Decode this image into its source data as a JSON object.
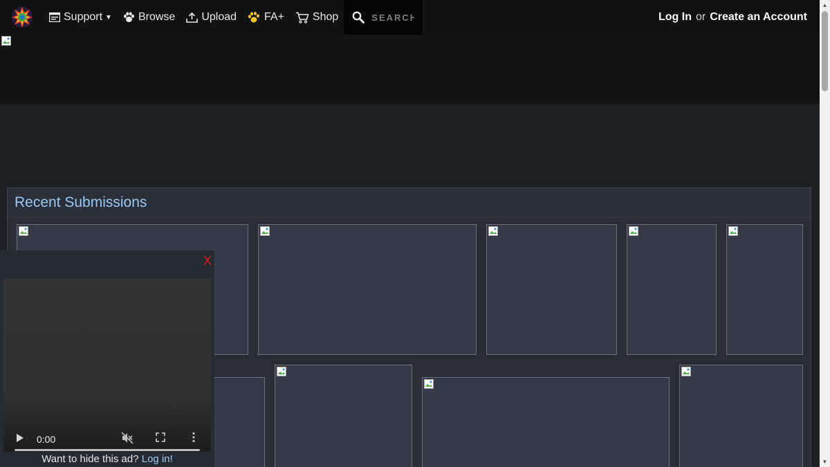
{
  "nav": {
    "items": [
      {
        "label": "Support",
        "icon": "support-icon",
        "has_dropdown": true
      },
      {
        "label": "Browse",
        "icon": "paw-icon"
      },
      {
        "label": "Upload",
        "icon": "upload-icon"
      },
      {
        "label": "FA+",
        "icon": "paw-plus-icon"
      },
      {
        "label": "Shop",
        "icon": "cart-icon"
      }
    ],
    "search_placeholder": "SEARCH",
    "login_label": "Log In",
    "or_label": "or",
    "create_account_label": "Create an Account"
  },
  "section": {
    "title": "Recent Submissions"
  },
  "ad": {
    "close_label": "X",
    "video_time": "0:00",
    "footer_text": "Want to hide this ad?",
    "footer_link": "Log in!"
  },
  "colors": {
    "nav_bg": "#121212",
    "page_bg": "#1f2023",
    "section_title": "#9cc8ef",
    "ad_close": "#e21b1b"
  }
}
